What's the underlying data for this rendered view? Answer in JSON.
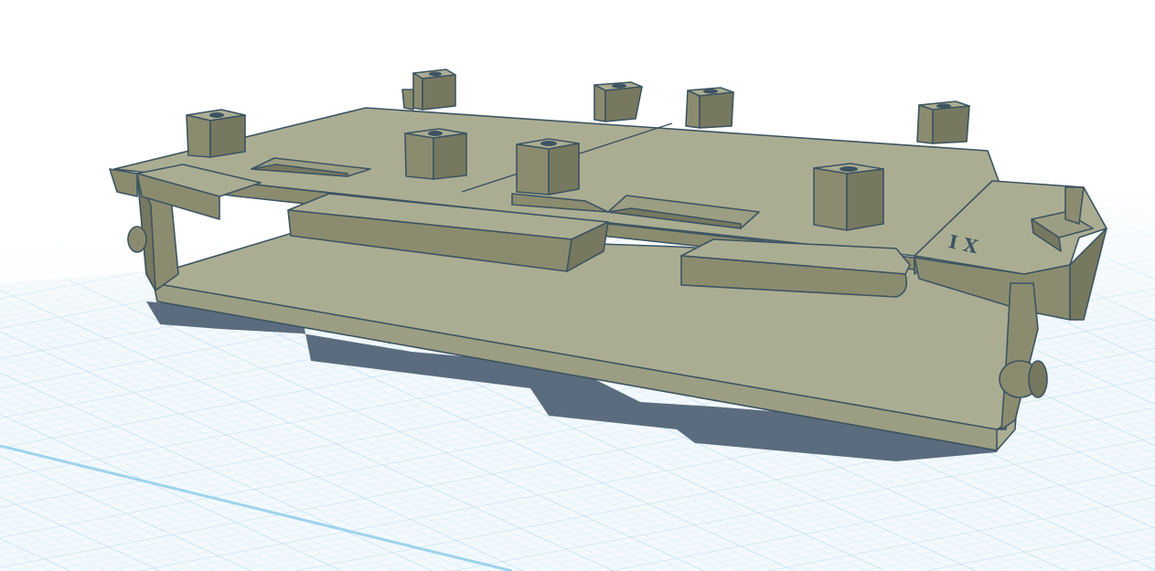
{
  "workplane": {
    "grid_color": "#bfe2f1",
    "major_grid_color": "#9cd0e8",
    "edge_color": "#9fd3ec"
  },
  "model": {
    "fill_top": "#abad93",
    "fill_side": "#8b8c6f",
    "fill_dark": "#777860",
    "edge_color": "#3d5461",
    "shadow_color": "#4a5c70",
    "engraving_text": "I X"
  }
}
